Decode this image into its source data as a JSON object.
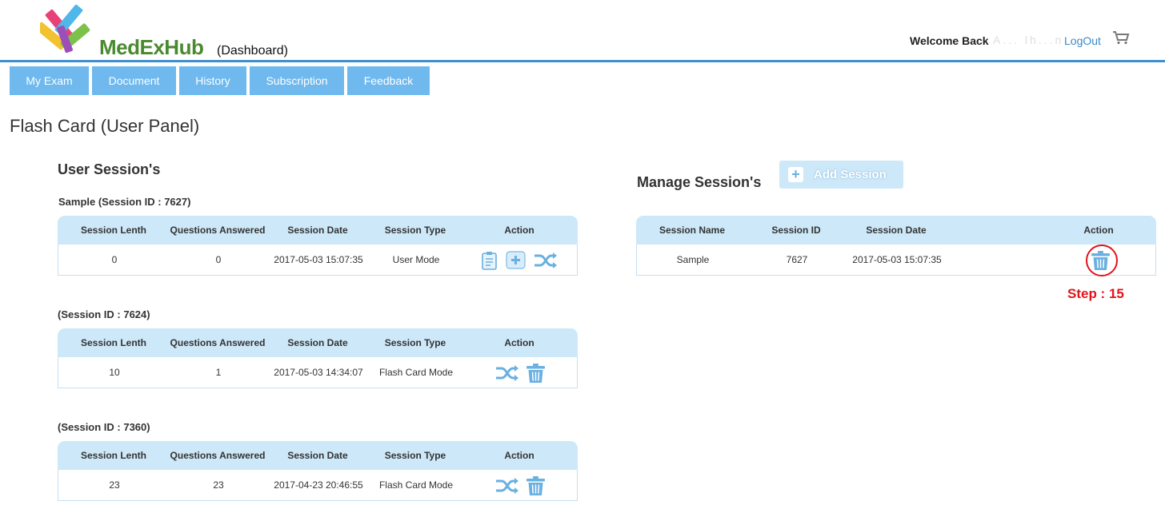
{
  "header": {
    "brand": "MedExHub",
    "subtitle": "(Dashboard)",
    "welcome": "Welcome Back",
    "username": "A...  lh...n",
    "logout": "LogOut",
    "cart_icon": "cart-icon"
  },
  "tabs": [
    {
      "label": "My Exam"
    },
    {
      "label": "Document"
    },
    {
      "label": "History"
    },
    {
      "label": "Subscription"
    },
    {
      "label": "Feedback"
    }
  ],
  "page_title": "Flash Card (User Panel)",
  "user_sessions": {
    "title": "User Session's",
    "columns": [
      "Session Lenth",
      "Questions Answered",
      "Session Date",
      "Session Type",
      "Action"
    ],
    "sessions": [
      {
        "heading": "Sample (Session ID : 7627)",
        "length": "0",
        "answered": "0",
        "date": "2017-05-03 15:07:35",
        "type": "User Mode",
        "actions": [
          "clipboard-icon",
          "add-icon",
          "shuffle-icon"
        ]
      },
      {
        "heading": "(Session ID : 7624)",
        "length": "10",
        "answered": "1",
        "date": "2017-05-03 14:34:07",
        "type": "Flash Card Mode",
        "actions": [
          "shuffle-icon",
          "trash-icon"
        ]
      },
      {
        "heading": "(Session ID : 7360)",
        "length": "23",
        "answered": "23",
        "date": "2017-04-23 20:46:55",
        "type": "Flash Card Mode",
        "actions": [
          "shuffle-icon",
          "trash-icon"
        ]
      }
    ]
  },
  "manage_sessions": {
    "title": "Manage Session's",
    "add_button": "Add Session",
    "columns": [
      "Session Name",
      "Session ID",
      "Session Date",
      "Action"
    ],
    "row": {
      "name": "Sample",
      "id": "7627",
      "date": "2017-05-03 15:07:35",
      "action": "trash-icon"
    }
  },
  "annotation": {
    "step": "Step : 15",
    "color": "#e0141b"
  },
  "colors": {
    "tab_bg": "#6fb9ee",
    "table_header_bg": "#cde8f8",
    "accent_line": "#3f8fcf",
    "brand_green": "#4a8a2f",
    "icon_blue": "#6ab0e0"
  }
}
